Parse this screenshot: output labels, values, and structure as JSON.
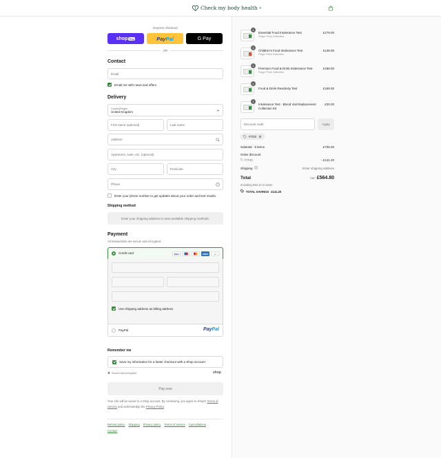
{
  "header": {
    "brand": "Check my body health",
    "brand_mark": "®"
  },
  "express": {
    "label": "Express checkout",
    "shop_pay": "shop",
    "shop_pay_tag": "Pay",
    "paypal_a": "Pay",
    "paypal_b": "Pal",
    "gpay": "G Pay",
    "or": "OR"
  },
  "contact": {
    "heading": "Contact",
    "email_placeholder": "Email",
    "newsletter_label": "Email me with news and offers"
  },
  "delivery": {
    "heading": "Delivery",
    "country_label": "Country/Region",
    "country_value": "United Kingdom",
    "first_name": "First name (optional)",
    "last_name": "Last name",
    "address": "Address",
    "apartment": "Apartment, suite, etc. (optional)",
    "city": "City",
    "postcode": "Postcode",
    "phone": "Phone",
    "sms_label": "Enter your phone number to get updates about your order and test results"
  },
  "shipping": {
    "heading": "Shipping method",
    "notice": "Enter your shipping address to view available shipping methods."
  },
  "payment": {
    "heading": "Payment",
    "sub": "All transactions are secure and encrypted.",
    "credit_card": "Credit card",
    "cards": [
      "VISA",
      "MC",
      "MC",
      "AMEX"
    ],
    "more_cards": "+4",
    "billing_label": "Use shipping address as billing address",
    "paypal": "PayPal",
    "paypal_logo_a": "Pay",
    "paypal_logo_b": "Pal"
  },
  "remember": {
    "heading": "Remember me",
    "save_label": "Save my information for a faster checkout with a Shop account",
    "secure": "Secure and encrypted",
    "shop": "shop"
  },
  "paynow": "Pay now",
  "legal": {
    "text": "Your info will be saved to a Shop account. By continuing, you agree to Shop's",
    "terms": "Terms of Service",
    "and": "and acknowledge the",
    "privacy": "Privacy Policy",
    "end": "."
  },
  "footer": [
    "Refund policy",
    "Shipping",
    "Privacy policy",
    "Terms of service",
    "Cancellations",
    "Contact"
  ],
  "cart": {
    "items": [
      {
        "qty": "1",
        "name": "Essential Food Intolerance Test",
        "sub": "Finger Prick Collection",
        "price": "£179.00"
      },
      {
        "qty": "1",
        "name": "Children's Food Intolerance Test",
        "sub": "Finger Prick Collection",
        "price": "£139.00"
      },
      {
        "qty": "1",
        "name": "Premium Food & Drink Intolerance Test",
        "sub": "Finger Prick Collection",
        "price": "£199.00"
      },
      {
        "qty": "1",
        "name": "Food & Drink Reactivity Test",
        "sub": "",
        "price": "£169.00"
      },
      {
        "qty": "1",
        "name": "Intolerance Test - Blood Vial Replacement Collection Kit",
        "sub": "",
        "price": "£20.00"
      }
    ],
    "discount_placeholder": "Discount code",
    "apply": "Apply",
    "code": "FIT20",
    "subtotal_label": "Subtotal · 5 items",
    "subtotal": "£706.00",
    "order_discount": "Order discount",
    "discount_code": "FIT20",
    "discount_value": "- £141.20",
    "shipping_label": "Shipping",
    "shipping_value": "Enter shipping address",
    "total_label": "Total",
    "currency": "GBP",
    "total": "£564.80",
    "taxes": "Including £94.13 in taxes",
    "savings_label": "TOTAL SAVINGS",
    "savings_value": "£141.20"
  }
}
